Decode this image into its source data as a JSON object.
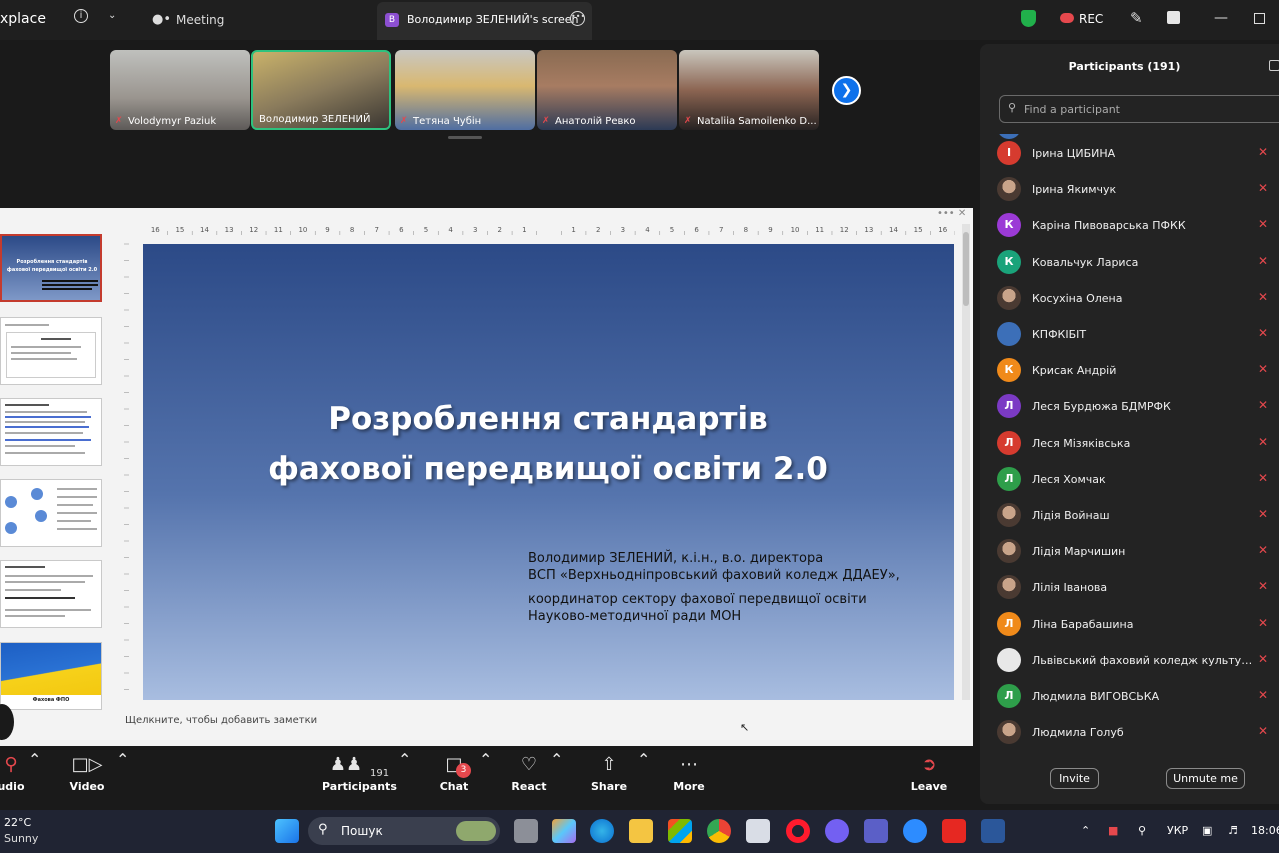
{
  "titlebar": {
    "app_title": "xplace",
    "meeting_label": "Meeting",
    "tab_badge": "B",
    "tab_title": "Володимир ЗЕЛЕНИЙ's screen",
    "rec_label": "REC",
    "shield_color": "#21b04b"
  },
  "videos": [
    {
      "name": "Volodymyr Paziuk",
      "muted": true
    },
    {
      "name": "Володимир ЗЕЛЕНИЙ",
      "muted": false,
      "active": true
    },
    {
      "name": "Тетяна Чубін",
      "muted": true
    },
    {
      "name": "Анатолій Ревко",
      "muted": true
    },
    {
      "name": "Nataliia Samoilenko D...",
      "muted": true
    }
  ],
  "slide": {
    "title_line1": "Розроблення стандартів",
    "title_line2": "фахової передвищої освіти 2.0",
    "author_line1": "Володимир ЗЕЛЕНИЙ, к.і.н., в.о. директора",
    "author_line2": "ВСП «Верхньодніпровський фаховий коледж ДДАЕУ»,",
    "author_line3": "координатор сектору фахової передвищої освіти",
    "author_line4": "Науково-методичної ради МОН",
    "notes_placeholder": "Щелкните, чтобы добавить заметки",
    "thumb1_line1": "Розроблення стандартів",
    "thumb1_line2": "фахової передвищої освіти 2.0",
    "thumb6_caption": "Фахова ФПО",
    "ruler_labels": [
      "16",
      "15",
      "14",
      "13",
      "12",
      "11",
      "10",
      "9",
      "8",
      "7",
      "6",
      "5",
      "4",
      "3",
      "2",
      "1",
      "",
      "1",
      "2",
      "3",
      "4",
      "5",
      "6",
      "7",
      "8",
      "9",
      "10",
      "11",
      "12",
      "13",
      "14",
      "15",
      "16"
    ]
  },
  "toolbar": {
    "audio": "udio",
    "video": "Video",
    "participants": "Participants",
    "participants_count": "191",
    "chat": "Chat",
    "chat_badge": "3",
    "react": "React",
    "share": "Share",
    "more": "More",
    "leave": "Leave"
  },
  "panel": {
    "title": "Participants (191)",
    "search_placeholder": "Find a participant",
    "invite": "Invite",
    "unmute": "Unmute me",
    "participants": [
      {
        "name": "Ірина ЦИБИНА",
        "initial": "І",
        "color": "#d63b2f"
      },
      {
        "name": "Ірина Якимчук",
        "initial": "",
        "color": "photo"
      },
      {
        "name": "Каріна Пивоварська ПФКК",
        "initial": "К",
        "color": "#9b3ad6"
      },
      {
        "name": "Ковальчук Лариса",
        "initial": "К",
        "color": "#1aa37a"
      },
      {
        "name": "Косухіна Олена",
        "initial": "",
        "color": "photo"
      },
      {
        "name": "КПФКІБІТ",
        "initial": "",
        "color": "#3c6fb8"
      },
      {
        "name": "Крисак Андрій",
        "initial": "К",
        "color": "#f08a1a"
      },
      {
        "name": "Леся Бурдюжа БДМРФК",
        "initial": "Л",
        "color": "#7b3ac4"
      },
      {
        "name": "Леся Мізяківська",
        "initial": "Л",
        "color": "#d63b2f"
      },
      {
        "name": "Леся Хомчак",
        "initial": "Л",
        "color": "#2e9e4a"
      },
      {
        "name": "Лідія Войнаш",
        "initial": "",
        "color": "photo"
      },
      {
        "name": "Лідія Марчишин",
        "initial": "",
        "color": "photo"
      },
      {
        "name": "Лілія Іванова",
        "initial": "",
        "color": "photo"
      },
      {
        "name": "Ліна Барабашина",
        "initial": "Л",
        "color": "#f08a1a"
      },
      {
        "name": "Львівський фаховий коледж культури і ми...",
        "initial": "",
        "color": "#e8e8e8"
      },
      {
        "name": "Людмила  ВИГОВСЬКА",
        "initial": "Л",
        "color": "#2e9e4a"
      },
      {
        "name": "Людмила Голуб",
        "initial": "",
        "color": "photo"
      }
    ]
  },
  "taskbar": {
    "temp": "22°C",
    "condition": "Sunny",
    "search": "Пошук",
    "lang": "УКР",
    "time": "18:06"
  }
}
